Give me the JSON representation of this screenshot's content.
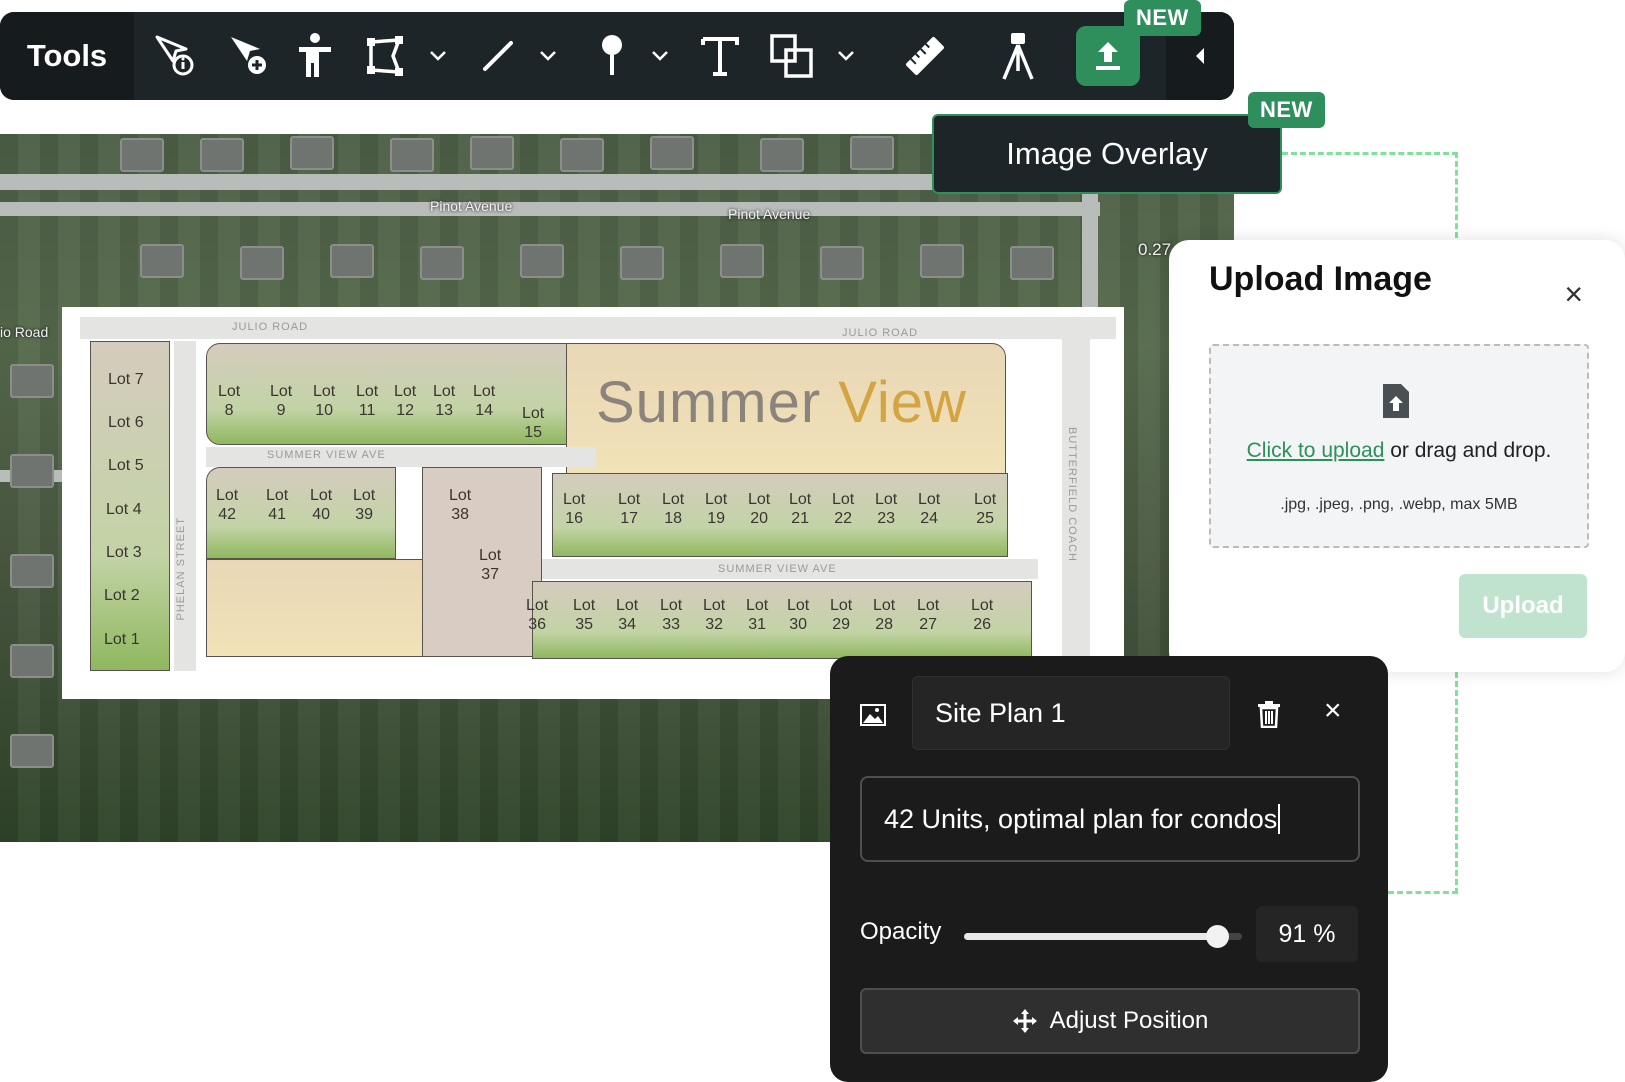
{
  "toolbar": {
    "title": "Tools",
    "new_badge": "NEW",
    "tools": [
      {
        "name": "select-info-icon"
      },
      {
        "name": "select-add-icon"
      },
      {
        "name": "person-icon"
      },
      {
        "name": "polygon-icon"
      },
      {
        "name": "line-icon"
      },
      {
        "name": "pin-icon"
      },
      {
        "name": "text-icon"
      },
      {
        "name": "shapes-icon"
      },
      {
        "name": "ruler-icon"
      },
      {
        "name": "survey-tripod-icon"
      },
      {
        "name": "upload-icon"
      }
    ],
    "accent": "#2f8f5c"
  },
  "tooltip": {
    "label": "Image Overlay",
    "badge": "NEW"
  },
  "map": {
    "street_labels": [
      "Pinot Avenue",
      "Pinot Avenue",
      "io Road",
      "0.27"
    ],
    "plan": {
      "brand_left": "Summer ",
      "brand_right": "View",
      "road_labels": [
        "JULIO ROAD",
        "JULIO ROAD",
        "SUMMER VIEW AVE",
        "SUMMER VIEW AVE",
        "BUTTERFIELD COACH",
        "PHELAN STREET"
      ],
      "lots": [
        "Lot 7",
        "Lot 6",
        "Lot 5",
        "Lot 4",
        "Lot 3",
        "Lot 2",
        "Lot 1",
        "Lot 8",
        "Lot 9",
        "Lot 10",
        "Lot 11",
        "Lot 12",
        "Lot 13",
        "Lot 14",
        "Lot 15",
        "Lot 42",
        "Lot 41",
        "Lot 40",
        "Lot 39",
        "Lot 38",
        "Lot 37",
        "Lot 16",
        "Lot 17",
        "Lot 18",
        "Lot 19",
        "Lot 20",
        "Lot 21",
        "Lot 22",
        "Lot 23",
        "Lot 24",
        "Lot 25",
        "Lot 36",
        "Lot 35",
        "Lot 34",
        "Lot 33",
        "Lot 32",
        "Lot 31",
        "Lot 30",
        "Lot 29",
        "Lot 28",
        "Lot 27",
        "Lot 26"
      ]
    }
  },
  "upload_panel": {
    "title": "Upload Image",
    "close": "×",
    "link_text": "Click to upload",
    "rest_text": " or drag and drop.",
    "formats": ".jpg, .jpeg, .png, .webp, max 5MB",
    "button": "Upload"
  },
  "overlay_panel": {
    "name": "Site Plan 1",
    "description": "42 Units, optimal plan for condos",
    "opacity_label": "Opacity",
    "opacity_value": "91 %",
    "opacity_fraction": 0.91,
    "adjust_label": "Adjust Position",
    "close": "×"
  }
}
